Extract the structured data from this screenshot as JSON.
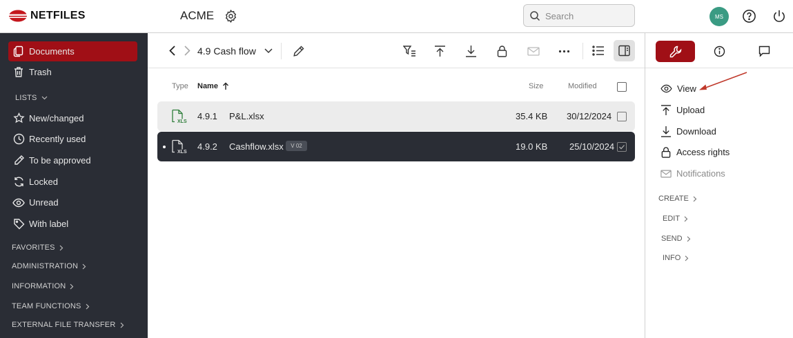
{
  "header": {
    "logo_text": "NETFILES",
    "company": "ACME",
    "search_placeholder": "Search",
    "avatar_initials": "MS"
  },
  "sidebar": {
    "items": [
      {
        "label": "Documents",
        "icon": "documents-icon",
        "active": true
      },
      {
        "label": "Trash",
        "icon": "trash-icon"
      }
    ],
    "lists_label": "LISTS",
    "list_items": [
      {
        "label": "New/changed",
        "icon": "star-icon"
      },
      {
        "label": "Recently used",
        "icon": "clock-icon"
      },
      {
        "label": "To be approved",
        "icon": "pencil-icon"
      },
      {
        "label": "Locked",
        "icon": "refresh-icon"
      },
      {
        "label": "Unread",
        "icon": "eye-icon"
      },
      {
        "label": "With label",
        "icon": "tag-icon"
      }
    ],
    "sections": [
      "FAVORITES",
      "ADMINISTRATION",
      "INFORMATION",
      "TEAM FUNCTIONS",
      "EXTERNAL FILE TRANSFER"
    ]
  },
  "toolbar": {
    "folder_title": "4.9 Cash flow"
  },
  "table": {
    "columns": {
      "type": "Type",
      "name": "Name",
      "size": "Size",
      "modified": "Modified"
    },
    "rows": [
      {
        "icon_label": "XLS",
        "number": "4.9.1",
        "name": "P&L.xlsx",
        "size": "35.4 KB",
        "modified": "30/12/2024",
        "selected": false
      },
      {
        "icon_label": "XLS",
        "number": "4.9.2",
        "name": "Cashflow.xlsx",
        "version": "V 02",
        "size": "19.0 KB",
        "modified": "25/10/2024",
        "selected": true
      }
    ]
  },
  "panel": {
    "actions": [
      {
        "label": "View",
        "icon": "eye-icon"
      },
      {
        "label": "Upload",
        "icon": "upload-icon"
      },
      {
        "label": "Download",
        "icon": "download-icon"
      },
      {
        "label": "Access rights",
        "icon": "lock-icon"
      },
      {
        "label": "Notifications",
        "icon": "mail-icon",
        "disabled": true
      }
    ],
    "sections": [
      "CREATE",
      "EDIT",
      "SEND",
      "INFO"
    ]
  },
  "colors": {
    "brand_red": "#a00f16",
    "sidebar_bg": "#2a2d35",
    "avatar": "#3a9b83",
    "xls_green": "#2e7d3a",
    "annotation_arrow": "#c0392b"
  }
}
